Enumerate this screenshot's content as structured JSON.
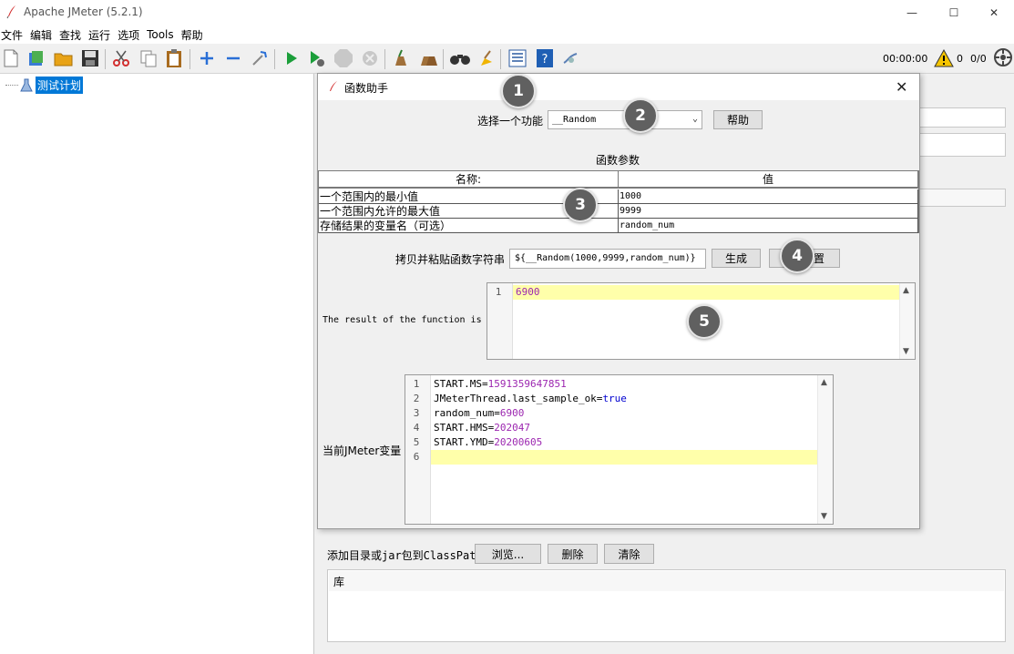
{
  "window": {
    "title": "Apache JMeter (5.2.1)",
    "minimize_label": "—",
    "maximize_label": "☐",
    "close_label": "✕"
  },
  "menu": [
    "文件",
    "编辑",
    "查找",
    "运行",
    "选项",
    "Tools",
    "帮助"
  ],
  "toolbar": {
    "timer": "00:00:00",
    "warning_count": "0",
    "threads": "0/0"
  },
  "tree": {
    "root_label": "测试计划"
  },
  "dialog": {
    "title": "函数助手",
    "close_label": "✕",
    "select_function_label": "选择一个功能",
    "selected_function": "__Random",
    "help_button": "帮助",
    "params_heading": "函数参数",
    "table": {
      "headers": [
        "名称:",
        "值"
      ],
      "rows": [
        {
          "name": "一个范围内的最小值",
          "value": "1000"
        },
        {
          "name": "一个范围内允许的最大值",
          "value": "9999"
        },
        {
          "name": "存储结果的变量名（可选）",
          "value": "random_num"
        }
      ]
    },
    "copy_label": "拷贝并粘贴函数字符串",
    "function_string": "${__Random(1000,9999,random_num)}",
    "generate_button": "生成",
    "reset_button_visible": "置",
    "result_label": "The result of the function is",
    "result_lines": [
      {
        "ln": "1",
        "text": "6900"
      }
    ],
    "vars_label": "当前JMeter变量",
    "vars_lines": [
      {
        "ln": "1",
        "key": "START.MS=",
        "val": "1591359647851"
      },
      {
        "ln": "2",
        "key": "JMeterThread.last_sample_ok=",
        "val": "true"
      },
      {
        "ln": "3",
        "key": "random_num=",
        "val": "6900"
      },
      {
        "ln": "4",
        "key": "START.HMS=",
        "val": "202047"
      },
      {
        "ln": "5",
        "key": "START.YMD=",
        "val": "20200605"
      },
      {
        "ln": "6",
        "key": "",
        "val": ""
      }
    ]
  },
  "classpath": {
    "label": "添加目录或jar包到ClassPath",
    "browse_button": "浏览...",
    "delete_button": "删除",
    "clear_button": "清除",
    "library_header": "库"
  },
  "markers": [
    "1",
    "2",
    "3",
    "4",
    "5"
  ],
  "colors": {
    "selection": "#0078d7",
    "highlight_line": "#ffffaa",
    "number": "#9c27b0",
    "boolean": "#0000d0",
    "marker": "#606060"
  }
}
